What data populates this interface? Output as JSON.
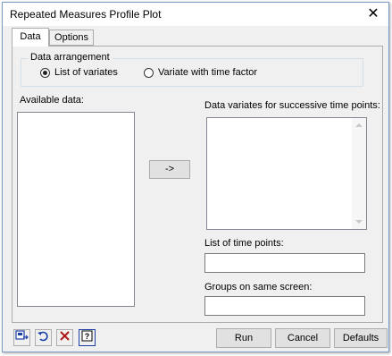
{
  "window": {
    "title": "Repeated Measures Profile Plot",
    "close_glyph": "✕"
  },
  "tabs": [
    {
      "label": "Data",
      "active": true
    },
    {
      "label": "Options",
      "active": false
    }
  ],
  "data_arrangement": {
    "legend": "Data arrangement",
    "options": [
      {
        "label": "List of variates",
        "selected": true
      },
      {
        "label": "Variate with time factor",
        "selected": false
      }
    ]
  },
  "available_data": {
    "label": "Available data:",
    "items": []
  },
  "transfer_button": {
    "label": "->"
  },
  "data_variates": {
    "label": "Data variates for successive time points:",
    "items": []
  },
  "time_points": {
    "label": "List of time points:",
    "value": ""
  },
  "groups": {
    "label": "Groups on same screen:",
    "value": ""
  },
  "toolbar_icons": [
    {
      "name": "save-settings-icon"
    },
    {
      "name": "restore-icon"
    },
    {
      "name": "clear-icon"
    },
    {
      "name": "help-icon"
    }
  ],
  "buttons": {
    "run": "Run",
    "cancel": "Cancel",
    "defaults": "Defaults"
  },
  "colors": {
    "icon_blue": "#1a3fa6",
    "clear_red": "#b01818"
  }
}
